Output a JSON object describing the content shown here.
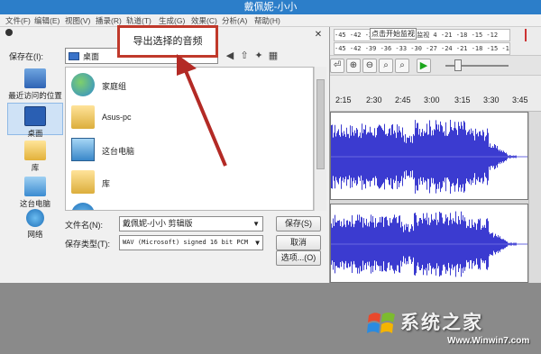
{
  "window": {
    "title": "戴佩妮-小小"
  },
  "menu": [
    "文件(F)",
    "编辑(E)",
    "视图(V)",
    "播录(R)",
    "轨道(T)",
    "生成(G)",
    "效果(C)",
    "分析(A)",
    "帮助(H)"
  ],
  "meter": {
    "row1": "-45 -42 -39 -3 点击开始监视 4 -21 -18 -15 -12",
    "row2": "-45 -42 -39 -36 -33 -30 -27 -24 -21 -18 -15 -12",
    "tip": "点击开始监视"
  },
  "timeline_ticks": [
    "2:15",
    "2:30",
    "2:45",
    "3:00",
    "3:15",
    "3:30",
    "3:45"
  ],
  "tooltip": "导出选择的音频",
  "dialog": {
    "savein_label": "保存在(I):",
    "location": "桌面",
    "places": [
      {
        "label": "最近访问的位置",
        "icon": "recent-places-icon"
      },
      {
        "label": "桌面",
        "icon": "desktop-icon"
      },
      {
        "label": "库",
        "icon": "library-icon"
      },
      {
        "label": "这台电脑",
        "icon": "this-pc-icon"
      },
      {
        "label": "网络",
        "icon": "network-icon"
      }
    ],
    "files": [
      {
        "label": "家庭组",
        "icon": "homegroup-icon"
      },
      {
        "label": "Asus-pc",
        "icon": "user-folder-icon"
      },
      {
        "label": "这台电脑",
        "icon": "computer-icon"
      },
      {
        "label": "库",
        "icon": "library-folder-icon"
      },
      {
        "label": "",
        "icon": "network-icon"
      }
    ],
    "filename_label": "文件名(N):",
    "filename_value": "戴佩妮-小小 剪辑版",
    "filetype_label": "保存类型(T):",
    "filetype_value": "WAV (Microsoft) signed 16 bit PCM",
    "save_button": "保存(S)",
    "cancel_button": "取消",
    "options_button": "选项...(O)"
  },
  "watermark": {
    "text": "系统之家",
    "url": "Www.Winwin7.com"
  },
  "colors": {
    "waveform": "#3b3bd0",
    "accent": "#c0392b",
    "titlebar": "#2c7ec9"
  }
}
